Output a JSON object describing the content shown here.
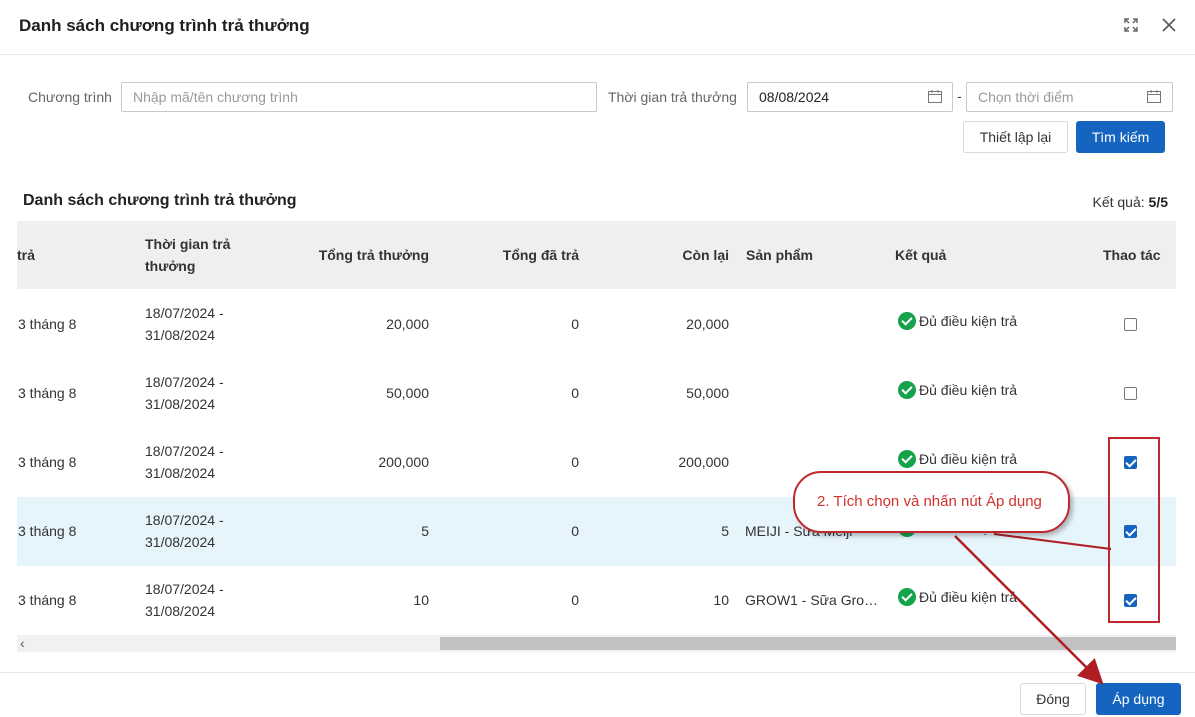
{
  "header": {
    "title": "Danh sách chương trình trả thưởng"
  },
  "filter": {
    "program_label": "Chương trình",
    "program_placeholder": "Nhập mã/tên chương trình",
    "time_label": "Thời gian trả thưởng",
    "date_from": "08/08/2024",
    "separator": "-",
    "date_to_placeholder": "Chọn thời điểm",
    "reset_label": "Thiết lập lại",
    "search_label": "Tìm kiếm"
  },
  "list": {
    "title": "Danh sách chương trình trả thưởng",
    "result_label": "Kết quả:",
    "result_value": "5/5"
  },
  "table": {
    "columns": {
      "c1": "trả",
      "c2a": "Thời gian trả",
      "c2b": "thưởng",
      "c3": "Tổng trả thưởng",
      "c4": "Tổng đã trả",
      "c5": "Còn lại",
      "c6": "Sản phẩm",
      "c7": "Kết quả",
      "c8": "Thao tác"
    },
    "rows": [
      {
        "name": "3 tháng 8",
        "date1": "18/07/2024 -",
        "date2": "31/08/2024",
        "total": "20,000",
        "paid": "0",
        "remain": "20,000",
        "product": "",
        "result": "Đủ điều kiện trả",
        "checked": false
      },
      {
        "name": "3 tháng 8",
        "date1": "18/07/2024 -",
        "date2": "31/08/2024",
        "total": "50,000",
        "paid": "0",
        "remain": "50,000",
        "product": "",
        "result": "Đủ điều kiện trả",
        "checked": false
      },
      {
        "name": "3 tháng 8",
        "date1": "18/07/2024 -",
        "date2": "31/08/2024",
        "total": "200,000",
        "paid": "0",
        "remain": "200,000",
        "product": "",
        "result": "Đủ điều kiện trả",
        "checked": true
      },
      {
        "name": "3 tháng 8",
        "date1": "18/07/2024 -",
        "date2": "31/08/2024",
        "total": "5",
        "paid": "0",
        "remain": "5",
        "product": "MEIJI - Sữa Meiji",
        "result": "Đủ điều kiện trả",
        "checked": true
      },
      {
        "name": "3 tháng 8",
        "date1": "18/07/2024 -",
        "date2": "31/08/2024",
        "total": "10",
        "paid": "0",
        "remain": "10",
        "product": "GROW1 - Sữa Gro…",
        "result": "Đủ điều kiện trả",
        "checked": true
      }
    ]
  },
  "footer": {
    "close_label": "Đóng",
    "apply_label": "Áp dụng"
  },
  "annotation": {
    "text": "2. Tích chọn và nhấn nút Áp dụng"
  },
  "colors": {
    "primary": "#1565c0",
    "success": "#14a34a",
    "annotation": "#c0282d",
    "highlight_row": "#e6f4fb"
  }
}
